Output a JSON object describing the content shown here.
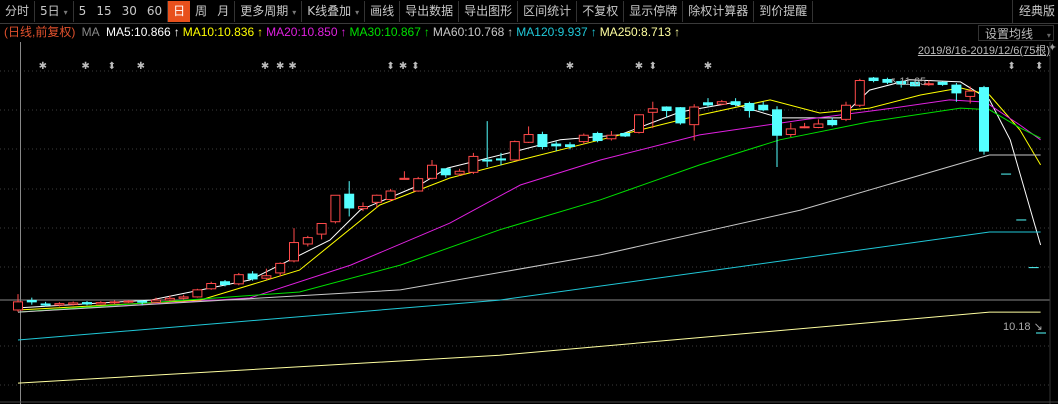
{
  "toolbar": {
    "items": [
      {
        "label": "分时"
      },
      {
        "label": "5日",
        "dropdown": true
      },
      {
        "label": "5"
      },
      {
        "label": "15"
      },
      {
        "label": "30"
      },
      {
        "label": "60"
      },
      {
        "label": "日",
        "active": true
      },
      {
        "label": "周"
      },
      {
        "label": "月"
      },
      {
        "label": "更多周期",
        "dropdown": true
      },
      {
        "label": "K线叠加",
        "dropdown": true
      },
      {
        "label": "画线"
      },
      {
        "label": "导出数据"
      },
      {
        "label": "导出图形"
      },
      {
        "label": "区间统计"
      },
      {
        "label": "不复权"
      },
      {
        "label": "显示停牌"
      },
      {
        "label": "除权计算器"
      },
      {
        "label": "到价提醒"
      }
    ],
    "classic_label": "经典版",
    "dropdown_icon": "▾"
  },
  "legend": {
    "period_label": "(日线,前复权)",
    "ma_label": "MA",
    "arrow": "↑",
    "items": [
      {
        "text": "MA5:10.866",
        "color": "#ffffff"
      },
      {
        "text": "MA10:10.836",
        "color": "#ffff00"
      },
      {
        "text": "MA20:10.850",
        "color": "#e020e0"
      },
      {
        "text": "MA30:10.867",
        "color": "#00e000"
      },
      {
        "text": "MA60:10.768",
        "color": "#c8c8c8"
      },
      {
        "text": "MA120:9.937",
        "color": "#20c8d8"
      },
      {
        "text": "MA250:8.713",
        "color": "#ffffa0"
      }
    ]
  },
  "ma_setting_label": "设置均线",
  "range_label": "2019/8/16-2019/12/6(75根)",
  "pin_icon": "📌",
  "high_label": "11.65",
  "last_label": "10.18",
  "last_arrow": "↘",
  "colors": {
    "up": "#ff4a4a",
    "down": "#54ffff",
    "grid": "#3c3c3c",
    "active": "#e8501c"
  },
  "chart_data": {
    "type": "candlestick",
    "price_range": [
      2.8,
      12.3
    ],
    "candles_ohlc": [
      [
        5.05,
        5.28,
        5.5,
        5.0
      ],
      [
        5.32,
        5.28,
        5.4,
        5.2
      ],
      [
        5.22,
        5.19,
        5.28,
        5.15
      ],
      [
        5.19,
        5.23,
        5.27,
        5.15
      ],
      [
        5.21,
        5.25,
        5.29,
        5.18
      ],
      [
        5.26,
        5.22,
        5.3,
        5.18
      ],
      [
        5.22,
        5.26,
        5.3,
        5.2
      ],
      [
        5.26,
        5.28,
        5.32,
        5.22
      ],
      [
        5.28,
        5.3,
        5.33,
        5.25
      ],
      [
        5.3,
        5.27,
        5.32,
        5.18
      ],
      [
        5.27,
        5.33,
        5.4,
        5.25
      ],
      [
        5.33,
        5.38,
        5.46,
        5.3
      ],
      [
        5.38,
        5.42,
        5.48,
        5.35
      ],
      [
        5.42,
        5.62,
        5.65,
        5.4
      ],
      [
        5.65,
        5.8,
        5.85,
        5.62
      ],
      [
        5.85,
        5.77,
        5.9,
        5.72
      ],
      [
        5.79,
        6.05,
        6.1,
        5.75
      ],
      [
        6.07,
        5.93,
        6.15,
        5.88
      ],
      [
        5.95,
        6.02,
        6.22,
        5.9
      ],
      [
        6.1,
        6.37,
        6.4,
        6.0
      ],
      [
        6.44,
        6.96,
        7.37,
        6.4
      ],
      [
        6.92,
        7.1,
        7.15,
        6.85
      ],
      [
        7.2,
        7.5,
        7.5,
        7.05
      ],
      [
        7.55,
        8.3,
        8.3,
        7.5
      ],
      [
        8.33,
        7.94,
        8.7,
        7.7
      ],
      [
        7.92,
        7.98,
        8.1,
        7.85
      ],
      [
        8.1,
        8.3,
        8.32,
        7.95
      ],
      [
        8.18,
        8.42,
        8.48,
        8.12
      ],
      [
        8.75,
        8.78,
        8.98,
        8.75
      ],
      [
        8.42,
        8.77,
        8.82,
        8.4
      ],
      [
        8.78,
        9.15,
        9.3,
        8.75
      ],
      [
        9.05,
        8.88,
        9.05,
        8.8
      ],
      [
        8.9,
        8.98,
        9.05,
        8.85
      ],
      [
        8.95,
        9.4,
        9.5,
        8.9
      ],
      [
        9.3,
        9.27,
        10.4,
        9.1
      ],
      [
        9.33,
        9.3,
        9.5,
        9.15
      ],
      [
        9.3,
        9.82,
        9.85,
        9.28
      ],
      [
        9.8,
        10.02,
        10.25,
        9.78
      ],
      [
        10.02,
        9.68,
        10.1,
        9.6
      ],
      [
        9.75,
        9.7,
        9.82,
        9.55
      ],
      [
        9.73,
        9.68,
        9.8,
        9.6
      ],
      [
        9.82,
        10.0,
        10.05,
        9.75
      ],
      [
        10.05,
        9.85,
        10.1,
        9.8
      ],
      [
        9.9,
        10.0,
        10.12,
        9.85
      ],
      [
        10.05,
        9.98,
        10.08,
        9.95
      ],
      [
        10.08,
        10.58,
        10.6,
        10.05
      ],
      [
        10.65,
        10.75,
        10.95,
        10.2
      ],
      [
        10.8,
        10.7,
        10.82,
        10.5
      ],
      [
        10.78,
        10.35,
        10.8,
        10.3
      ],
      [
        10.3,
        10.8,
        10.88,
        9.85
      ],
      [
        10.92,
        10.86,
        11.05,
        10.8
      ],
      [
        10.88,
        10.95,
        11.0,
        10.85
      ],
      [
        10.95,
        10.87,
        11.05,
        10.82
      ],
      [
        10.9,
        10.7,
        10.95,
        10.5
      ],
      [
        10.85,
        10.72,
        10.95,
        10.68
      ],
      [
        10.72,
        10.0,
        10.82,
        9.1
      ],
      [
        10.02,
        10.18,
        10.35,
        9.95
      ],
      [
        10.22,
        10.24,
        10.35,
        10.2
      ],
      [
        10.22,
        10.32,
        10.45,
        10.2
      ],
      [
        10.42,
        10.3,
        10.5,
        10.25
      ],
      [
        10.45,
        10.85,
        10.95,
        10.4
      ],
      [
        10.85,
        11.55,
        11.6,
        10.8
      ],
      [
        11.62,
        11.55,
        11.65,
        11.5
      ],
      [
        11.58,
        11.5,
        11.63,
        11.45
      ],
      [
        11.52,
        11.45,
        11.55,
        11.35
      ],
      [
        11.5,
        11.4,
        11.55,
        11.38
      ],
      [
        11.44,
        11.46,
        11.55,
        11.4
      ],
      [
        11.5,
        11.44,
        11.52,
        11.4
      ],
      [
        11.42,
        11.2,
        11.48,
        10.95
      ],
      [
        11.1,
        11.25,
        11.38,
        10.9
      ],
      [
        11.35,
        9.55,
        11.4,
        9.45
      ]
    ],
    "projection_marks": [
      [
        71.6,
        8.9
      ],
      [
        72.7,
        7.6
      ],
      [
        73.6,
        6.25
      ]
    ],
    "ma_series": [
      {
        "name": "MA5",
        "color": "#ffffff",
        "points": [
          [
            0,
            5.11
          ],
          [
            9.6,
            5.33
          ],
          [
            16.8,
            5.9
          ],
          [
            22.6,
            7.03
          ],
          [
            24.8,
            7.88
          ],
          [
            29.1,
            8.59
          ],
          [
            31.1,
            9.07
          ],
          [
            36.4,
            9.58
          ],
          [
            39.3,
            9.87
          ],
          [
            43.6,
            10.01
          ],
          [
            48,
            10.66
          ],
          [
            51.6,
            10.91
          ],
          [
            55.2,
            10.49
          ],
          [
            59.6,
            10.49
          ],
          [
            61.7,
            11.28
          ],
          [
            64.6,
            11.57
          ],
          [
            68.3,
            11.51
          ],
          [
            70.4,
            11.0
          ],
          [
            71.9,
            9.87
          ],
          [
            74.1,
            6.89
          ]
        ]
      },
      {
        "name": "MA10",
        "color": "#ffff00",
        "points": [
          [
            0,
            5.05
          ],
          [
            13.2,
            5.33
          ],
          [
            20.4,
            6.18
          ],
          [
            26.2,
            8.02
          ],
          [
            31.3,
            8.79
          ],
          [
            36.4,
            9.3
          ],
          [
            42.2,
            9.87
          ],
          [
            49.4,
            10.57
          ],
          [
            54.5,
            11.0
          ],
          [
            58.1,
            10.63
          ],
          [
            61.7,
            10.77
          ],
          [
            65.4,
            11.14
          ],
          [
            68.3,
            11.34
          ],
          [
            70.4,
            11.14
          ],
          [
            72.6,
            10.15
          ],
          [
            74.1,
            9.16
          ]
        ]
      },
      {
        "name": "MA20",
        "color": "#e020e0",
        "points": [
          [
            0,
            4.99
          ],
          [
            16.8,
            5.39
          ],
          [
            24.1,
            6.32
          ],
          [
            31.3,
            7.51
          ],
          [
            36.4,
            8.59
          ],
          [
            42.2,
            9.3
          ],
          [
            49.4,
            10.01
          ],
          [
            56.7,
            10.43
          ],
          [
            62.5,
            10.72
          ],
          [
            67.5,
            11.0
          ],
          [
            70.1,
            10.94
          ],
          [
            72.6,
            10.29
          ],
          [
            74.1,
            9.87
          ]
        ]
      },
      {
        "name": "MA30",
        "color": "#00e000",
        "points": [
          [
            0,
            4.99
          ],
          [
            20.4,
            5.56
          ],
          [
            27.7,
            6.32
          ],
          [
            34.9,
            7.32
          ],
          [
            42.2,
            8.17
          ],
          [
            49.4,
            9.16
          ],
          [
            55.2,
            9.87
          ],
          [
            61.7,
            10.38
          ],
          [
            68.3,
            10.77
          ],
          [
            70.4,
            10.72
          ],
          [
            72.6,
            10.21
          ],
          [
            74.1,
            9.92
          ]
        ]
      },
      {
        "name": "MA60",
        "color": "#c8c8c8",
        "points": [
          [
            0,
            4.99
          ],
          [
            27.7,
            5.62
          ],
          [
            42.2,
            6.61
          ],
          [
            56.7,
            7.88
          ],
          [
            70.4,
            9.44
          ],
          [
            74.1,
            9.44
          ]
        ]
      },
      {
        "name": "MA120",
        "color": "#20c8d8",
        "points": [
          [
            0,
            4.2
          ],
          [
            34.9,
            5.33
          ],
          [
            70.4,
            7.26
          ],
          [
            74.1,
            7.26
          ]
        ]
      },
      {
        "name": "MA250",
        "color": "#ffffa0",
        "points": [
          [
            0,
            2.98
          ],
          [
            34.9,
            3.77
          ],
          [
            70.4,
            4.99
          ],
          [
            74.1,
            4.99
          ]
        ]
      }
    ],
    "event_markers": [
      {
        "index": 1.8,
        "kind": "star"
      },
      {
        "index": 4.9,
        "kind": "star"
      },
      {
        "index": 6.8,
        "kind": "updown"
      },
      {
        "index": 8.9,
        "kind": "star"
      },
      {
        "index": 17.9,
        "kind": "star"
      },
      {
        "index": 19,
        "kind": "star"
      },
      {
        "index": 19.9,
        "kind": "star"
      },
      {
        "index": 27,
        "kind": "updown"
      },
      {
        "index": 27.9,
        "kind": "star"
      },
      {
        "index": 28.8,
        "kind": "updown"
      },
      {
        "index": 40,
        "kind": "star"
      },
      {
        "index": 45,
        "kind": "star"
      },
      {
        "index": 46,
        "kind": "updown"
      },
      {
        "index": 50,
        "kind": "star"
      },
      {
        "index": 72,
        "kind": "updown"
      },
      {
        "index": 74,
        "kind": "updown"
      }
    ],
    "marker_glyphs": {
      "star": "✱",
      "updown": "⬍"
    }
  }
}
